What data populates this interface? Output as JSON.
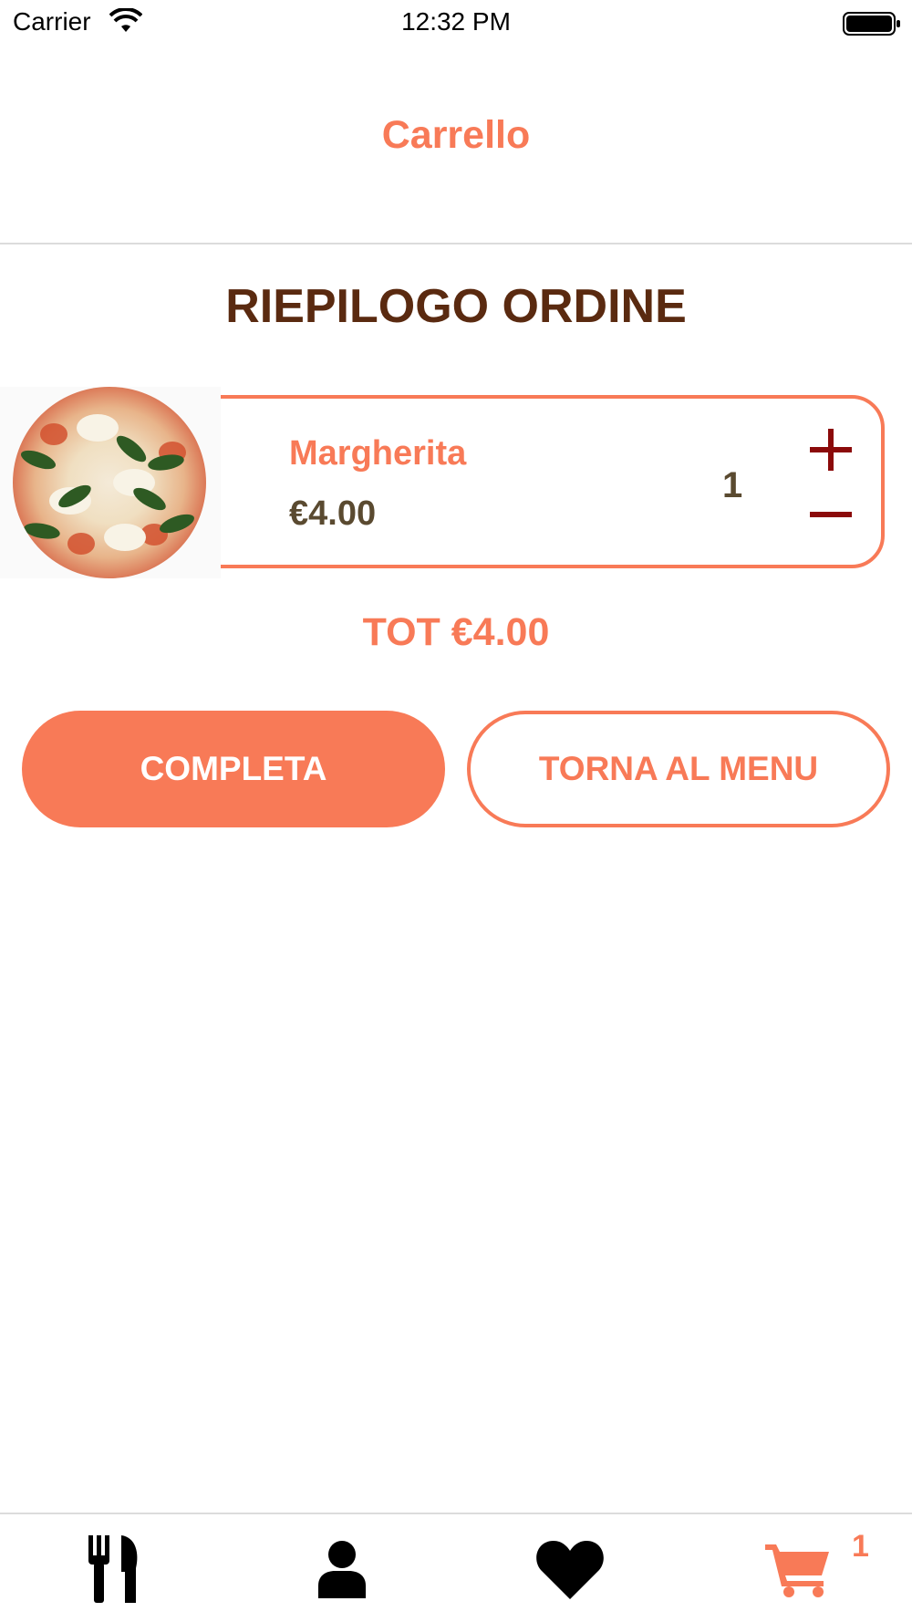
{
  "status_bar": {
    "carrier": "Carrier",
    "time": "12:32 PM",
    "icons": [
      "wifi-icon",
      "battery-icon"
    ]
  },
  "nav": {
    "title": "Carrello"
  },
  "summary": {
    "title": "RIEPILOGO ORDINE"
  },
  "cart": {
    "items": [
      {
        "name": "Margherita",
        "price": "€4.00",
        "quantity": "1",
        "image": "pizza-margherita-image"
      }
    ],
    "increase_icon": "plus-icon",
    "decrease_icon": "minus-icon"
  },
  "total": "TOT €4.00",
  "actions": {
    "complete_label": "COMPLETA",
    "back_label": "TORNA AL MENU"
  },
  "tab_bar": {
    "tabs": [
      {
        "icon": "fork-knife-icon",
        "active": false
      },
      {
        "icon": "user-icon",
        "active": false
      },
      {
        "icon": "heart-icon",
        "active": false
      },
      {
        "icon": "cart-icon",
        "active": true
      }
    ],
    "cart_badge": "1"
  },
  "colors": {
    "accent": "#f87a57",
    "title_brown": "#5a2a10",
    "price_brown": "#5a4a30",
    "qty_control": "#8b0a0a",
    "tab_icon": "#000000"
  }
}
